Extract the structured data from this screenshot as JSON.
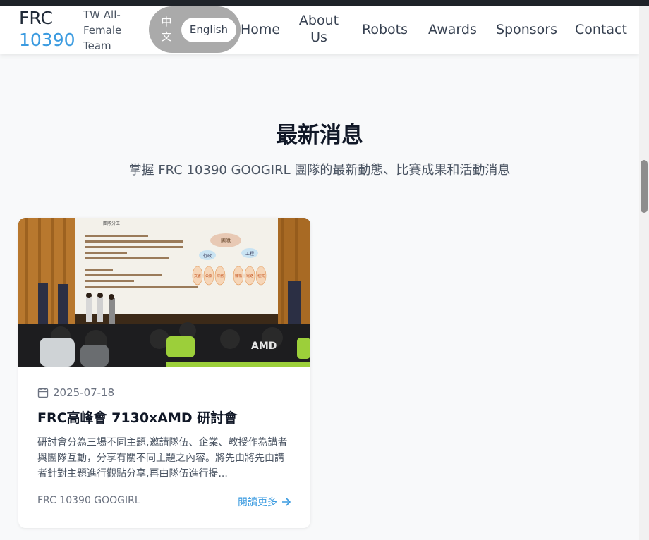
{
  "brand": {
    "line1": "FRC",
    "line2": "10390",
    "subtitle": "TW All-Female Team"
  },
  "lang": {
    "zh": "中文",
    "en": "English"
  },
  "nav": {
    "home": "Home",
    "about": "About Us",
    "robots": "Robots",
    "awards": "Awards",
    "sponsors": "Sponsors",
    "contact": "Contact"
  },
  "news": {
    "title": "最新消息",
    "subtitle": "掌握 FRC 10390 GOOGIRL 團隊的最新動態、比賽成果和活動消息",
    "cards": [
      {
        "date": "2025-07-18",
        "title": "FRC高峰會 7130xAMD 研討會",
        "excerpt": "研討會分為三場不同主題,邀請隊伍、企業、教授作為講者與團隊互動，分享有關不同主題之內容。將先由將先由講者針對主題進行觀點分享,再由隊伍進行提...",
        "author": "FRC 10390 GOOGIRL",
        "read_more": "閱讀更多",
        "image": {
          "slide_title": "團隊分工",
          "slide_center": "團隊",
          "slide_left": "行政",
          "slide_right": "工程",
          "slide_boxes": [
            "文書",
            "公關",
            "財務",
            "機構",
            "電路",
            "程式"
          ],
          "stage_sign": "AMD"
        }
      }
    ]
  },
  "colors": {
    "accent": "#3b9be0",
    "toggle_bg": "#aaaaaa",
    "topbar": "#1f2329"
  },
  "icons": {
    "date": "calendar-icon",
    "read_more": "arrow-right-icon"
  }
}
